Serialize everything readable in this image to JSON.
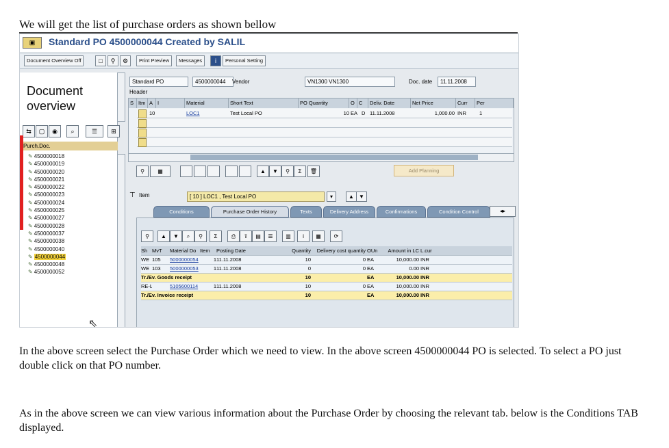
{
  "doc": {
    "heading": "We will get the list of purchase orders as shown bellow",
    "para1": "In the above screen select the Purchase Order which we need to view. In the above screen 4500000044 PO is selected. To select a PO just double click on that PO number.",
    "para2": "As in the above screen we can view various information about the Purchase Order by choosing the relevant tab. below is the Conditions TAB displayed."
  },
  "sap": {
    "title": "Standard PO 4500000044 Created by SALIL",
    "toolbar": {
      "doc_overview_off": "Document Overview Off",
      "print_preview": "Print Preview",
      "messages": "Messages",
      "personal_setting": "Personal Setting"
    },
    "left": {
      "title": "Document overview",
      "list_header": "Purch.Doc.",
      "items": [
        "4500000018",
        "4500000019",
        "4500000020",
        "4500000021",
        "4500000022",
        "4500000023",
        "4500000024",
        "4500000025",
        "4500000027",
        "4500000028",
        "4500000037",
        "4500000038",
        "4500000040",
        "4500000044",
        "4500000048",
        "4500000052"
      ],
      "selected": "4500000044"
    },
    "header": {
      "doc_type": "Standard PO",
      "po_number": "4500000044",
      "vendor_label": "Vendor",
      "vendor_value": "VN1300 VN1300",
      "doc_date_label": "Doc. date",
      "doc_date_value": "11.11.2008",
      "header_label": "Header"
    },
    "items_grid": {
      "columns": [
        "S",
        "Itm",
        "A",
        "I",
        "Material",
        "Short Text",
        "PO Quantity",
        "O",
        "C",
        "Deliv. Date",
        "Net Price",
        "Curr",
        "Per"
      ],
      "row": {
        "item": "10",
        "material": "LOC1",
        "short_text": "Test Local PO",
        "qty": "10",
        "unit": "EA",
        "cat": "D",
        "date": "11.11.2008",
        "price": "1,000.00",
        "curr": "INR",
        "per": "1"
      }
    },
    "add_planning": "Add Planning",
    "item_selector": {
      "label": "Item",
      "value": "[ 10 ] LOC1 , Test Local PO"
    },
    "tabs": [
      "Conditions",
      "Purchase Order History",
      "Texts",
      "Delivery Address",
      "Confirmations",
      "Condition Control"
    ],
    "active_tab": "Purchase Order History",
    "history": {
      "columns": [
        "Sh",
        "MvT",
        "Material Do",
        "Item",
        "Posting Date",
        "Quantity",
        "Delivery cost quantity",
        "OUn",
        "Amount in LC",
        "L.cur"
      ],
      "rows": [
        {
          "kind": "data",
          "sh": "WE",
          "mvt": "105",
          "doc": "5000000054",
          "item": "1",
          "date": "11.11.2008",
          "qty": "10",
          "dcq": "0",
          "oun": "EA",
          "amt": "10,000.00",
          "cur": "INR"
        },
        {
          "kind": "data",
          "sh": "WE",
          "mvt": "103",
          "doc": "5000000053",
          "item": "1",
          "date": "11.11.2008",
          "qty": "0",
          "dcq": "0",
          "oun": "EA",
          "amt": "0.00",
          "cur": "INR"
        },
        {
          "kind": "sum",
          "sh": "Tr./Ev. Goods receipt",
          "mvt": "",
          "doc": "",
          "item": "",
          "date": "",
          "qty": "10",
          "dcq": "",
          "oun": "EA",
          "amt": "10,000.00",
          "cur": "INR"
        },
        {
          "kind": "data",
          "sh": "RE-L",
          "mvt": "",
          "doc": "5105600114",
          "item": "1",
          "date": "11.11.2008",
          "qty": "10",
          "dcq": "0",
          "oun": "EA",
          "amt": "10,000.00",
          "cur": "INR"
        },
        {
          "kind": "sum",
          "sh": "Tr./Ev. Invoice receipt",
          "mvt": "",
          "doc": "",
          "item": "",
          "date": "",
          "qty": "10",
          "dcq": "",
          "oun": "EA",
          "amt": "10,000.00",
          "cur": "INR"
        }
      ]
    }
  }
}
